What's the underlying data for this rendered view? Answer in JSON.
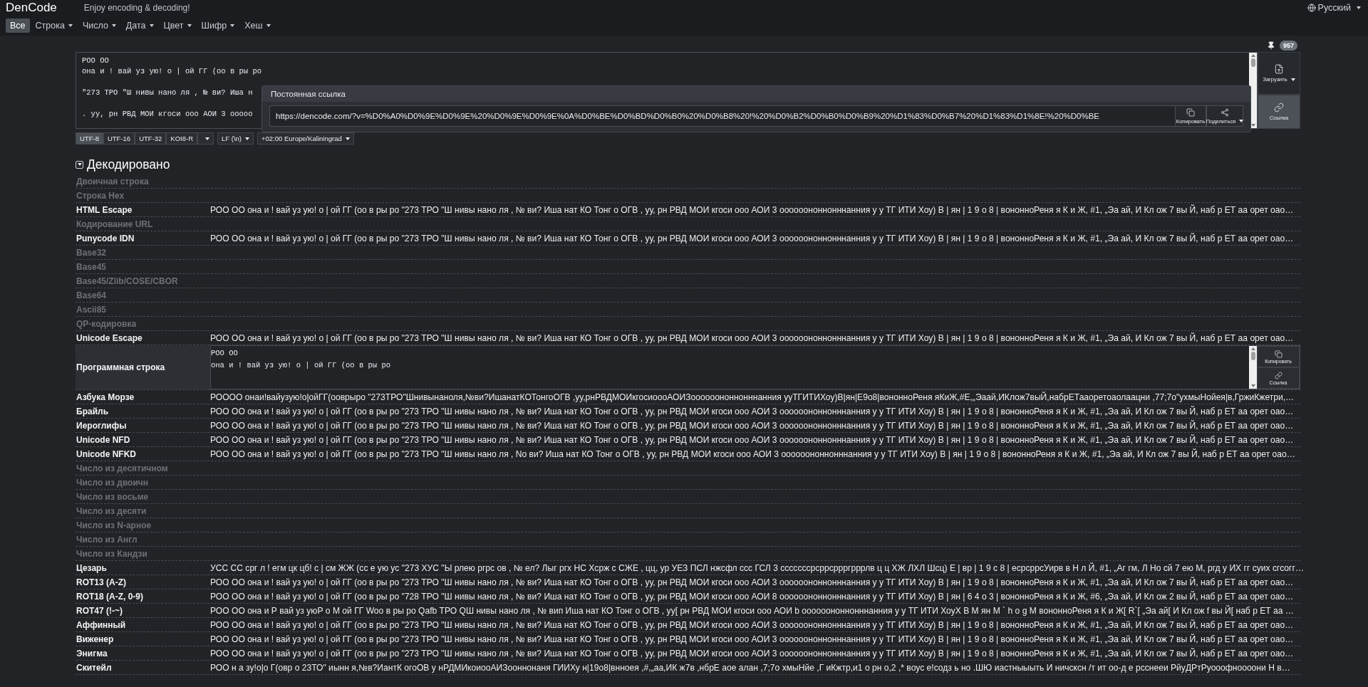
{
  "header": {
    "brand": "DenCode",
    "tagline": "Enjoy encoding & decoding!",
    "language": "Русский"
  },
  "nav": [
    {
      "label": "Все",
      "selected": true,
      "dropdown": false
    },
    {
      "label": "Строка",
      "selected": false,
      "dropdown": true
    },
    {
      "label": "Число",
      "selected": false,
      "dropdown": true
    },
    {
      "label": "Дата",
      "selected": false,
      "dropdown": true
    },
    {
      "label": "Цвет",
      "selected": false,
      "dropdown": true
    },
    {
      "label": "Шифр",
      "selected": false,
      "dropdown": true
    },
    {
      "label": "Хеш",
      "selected": false,
      "dropdown": true
    }
  ],
  "input": {
    "count": "957",
    "paragraphs": [
      [
        "РОО ОО",
        "она и ! вай уз ую! о | ой ГГ (оо в ры ро"
      ],
      [
        "\"273 ТРО \"Ш нивы нано ля , № ви? Иша н"
      ],
      [
        ". уу, рн РВД МОИ кгоси ооо АОИ 3 ооооо"
      ]
    ]
  },
  "side_buttons": [
    {
      "label": "Загрузить",
      "kind": "upload",
      "selected": false,
      "dropdown": true
    },
    {
      "label": "Ссылка",
      "kind": "link",
      "selected": true,
      "dropdown": false
    }
  ],
  "permalink": {
    "title": "Постоянная ссылка",
    "url": "https://dencode.com/?v=%D0%A0%D0%9E%D0%9E%20%D0%9E%D0%9E%0A%D0%BE%D0%BD%D0%B0%20%D0%B8%20!%20%D0%B2%D0%B0%D0%B9%20%D1%83%D0%B7%20%D1%83%D1%8E!%20%D0%BE",
    "buttons": [
      {
        "label": "Копировать",
        "kind": "copy",
        "dropdown": false
      },
      {
        "label": "Поделиться",
        "kind": "share",
        "dropdown": true
      }
    ]
  },
  "encodings": [
    {
      "label": "UTF-8",
      "selected": true
    },
    {
      "label": "UTF-16",
      "selected": false
    },
    {
      "label": "UTF-32",
      "selected": false
    },
    {
      "label": "KOI8-R",
      "selected": false
    }
  ],
  "line_break": "LF (\\n)",
  "timezone": "+02:00 Europe/Kaliningrad",
  "decoded": {
    "title": "Декодировано",
    "expanded": true,
    "rows": [
      {
        "label": "Двоичная строка",
        "kind": "empty"
      },
      {
        "label": "Строка Hex",
        "kind": "empty"
      },
      {
        "label": "HTML Escape",
        "kind": "text",
        "value": "РОО ОО она и ! вай уз ую! о | ой ГГ (оо в ры ро \"273 ТРО \"Ш нивы нано ля , № ви? Иша нат КО Тонг о ОГВ , уу, рн РВД МОИ кгоси ооо АОИ 3 оооооононнонннанния у у ТГ ИТИ Хоу) В | ян | 1 9 о 8 | вононноРеня я К и Ж, #1, „Эа ай, И Кл ож 7 вы Й, наб р ЕТ аа орет оао…"
      },
      {
        "label": "Кодирование URL",
        "kind": "empty"
      },
      {
        "label": "Punycode IDN",
        "kind": "text",
        "value": "РОО ОО она и ! вай уз ую! о | ой ГГ (оо в ры ро \"273 ТРО \"Ш нивы нано ля , № ви? Иша нат КО Тонг о ОГВ , уу, рн РВД МОИ кгоси ооо АОИ 3 оооооононнонннанния у у ТГ ИТИ Хоу) В | ян | 1 9 о 8 | вононноРеня я К и Ж, #1, „Эа ай, И Кл ож 7 вы Й, наб р ЕТ аа орет оао…"
      },
      {
        "label": "Base32",
        "kind": "empty"
      },
      {
        "label": "Base45",
        "kind": "empty"
      },
      {
        "label": "Base45/Zlib/COSE/CBOR",
        "kind": "empty"
      },
      {
        "label": "Base64",
        "kind": "empty"
      },
      {
        "label": "Ascii85",
        "kind": "empty"
      },
      {
        "label": "QP-кодировка",
        "kind": "empty"
      },
      {
        "label": "Unicode Escape",
        "kind": "text",
        "value": "РОО ОО она и ! вай уз ую! о | ой ГГ (оо в ры ро \"273 ТРО \"Ш нивы нано ля , № ви? Иша нат КО Тонг о ОГВ , уу, рн РВД МОИ кгоси ооо АОИ 3 оооооононнонннанния у у ТГ ИТИ Хоу) В | ян | 1 9 о 8 | вононноРеня я К и Ж, #1, „Эа ай, И Кл ож 7 вы Й, наб р ЕТ аа орет оао…"
      },
      {
        "label": "Программная строка",
        "kind": "program",
        "lines": [
          "РОО ОО",
          "она и ! вай уз ую! о | ой ГГ (оо в ры ро"
        ],
        "buttons": [
          {
            "label": "Копировать",
            "kind": "copy",
            "dropdown": false
          },
          {
            "label": "Ссылка",
            "kind": "link",
            "dropdown": false
          }
        ]
      },
      {
        "label": "Азбука Морзе",
        "kind": "text",
        "value": "РОООО онаи!вайузую!о|ойГГ(ооврыро \"273ТРО\"Шнивынаноля,№ви?ИшанатКОТонгоОГВ ,уу,рнРВДМОИкгосиоооАОИЗоооооононнонннанния ууТГИТИХоу)В|ян|E9о8|вононноРеня яКиЖ,#E,„Эаай,ИКлож7выЙ,набрЕТааоретоаолаацни ,77;7о\"ухмыНойея|в,ГржиКжетри,…"
      },
      {
        "label": "Брайль",
        "kind": "text",
        "value": "РОО ОО она и ! вай уз ую! о | ой ГГ (оо в ры ро \"273 ТРО \"Ш нивы нано ля , № ви? Иша нат КО Тонг о ОГВ , уу, рн РВД МОИ кгоси ооо АОИ 3 оооооононнонннанния у у ТГ ИТИ Хоу) В | ян | 1 9 о 8 | вононноРеня я К и Ж, #1, „Эа ай, И Кл ож 7 вы Й, наб р ЕТ аа орет оао…"
      },
      {
        "label": "Иероглифы",
        "kind": "text",
        "value": "РОО ОО она и ! вай уз ую! о | ой ГГ (оо в ры ро \"273 ТРО \"Ш нивы нано ля , № ви? Иша нат КО Тонг о ОГВ , уу, рн РВД МОИ кгоси ооо АОИ 3 оооооононнонннанния у у ТГ ИТИ Хоу) В | ян | 1 9 о 8 | вононноРеня я К и Ж, #1, „Эа ай, И Кл ож 7 вы Й, наб р ЕТ аа орет оао…"
      },
      {
        "label": "Unicode NFD",
        "kind": "text",
        "value": "РОО ОО она и ! вай уз ую! о | ой ГГ (оо в ры ро \"273 ТРО \"Ш нивы нано ля , № ви? Иша нат КО Тонг о ОГВ , уу, рн РВД МОИ кгоси ооо АОИ 3 оооооононнонннанния у у ТГ ИТИ Хоу) В | ян | 1 9 о 8 | вононноРеня я К и Ж, #1, „Эа ай, И Кл ож 7 вы Й, наб р ЕТ аа орет оао…"
      },
      {
        "label": "Unicode NFKD",
        "kind": "text",
        "value": "РОО ОО она и ! вай уз ую! о | ой ГГ (оо в ры ро \"273 ТРО \"Ш нивы нано ля , No ви? Иша нат КО Тонг о ОГВ , уу, рн РВД МОИ кгоси ооо АОИ 3 оооооононнонннанния у у ТГ ИТИ Хоу) В | ян | 1 9 о 8 | вононноРеня я К и Ж, #1, „Эа ай, И Кл ож 7 вы Й, наб р ЕТ аа орет оао…"
      },
      {
        "label": "Число из десятичном",
        "kind": "empty"
      },
      {
        "label": "Число из двоичн",
        "kind": "empty"
      },
      {
        "label": "Число из восьме",
        "kind": "empty"
      },
      {
        "label": "Число из десяти",
        "kind": "empty"
      },
      {
        "label": "Число из N-арное",
        "kind": "empty"
      },
      {
        "label": "Число из Англ",
        "kind": "empty"
      },
      {
        "label": "Число из Кандзи",
        "kind": "empty"
      },
      {
        "label": "Цезарь",
        "kind": "text",
        "value": "УСС СС срг л ! егм цк цб! с | см ЖЖ (сс е ую ус \"273 ХУС \"Ы рлею ргрс ов , № ел? Лыг ргх НС Хсрж с СЖЕ , цц, ур УЕЗ ПСЛ нжсфл ссс ГСЛ 3 сссссссрсррсррргрррлв ц ц ХЖ ЛХЛ Шсц) Е | вр | 1 9 с 8 | есрсррсУирв в Н л Й, #1, „Аг гм, Л Но сй 7 ею М, ргд у ИХ гг суих сгсогг…"
      },
      {
        "label": "ROT13 (A-Z)",
        "kind": "text",
        "value": "РОО ОО она и ! вай уз ую! о | ой ГГ (оо в ры ро \"273 ТРО \"Ш нивы нано ля , № ви? Иша нат КО Тонг о ОГВ , уу, рн РВД МОИ кгоси ооо АОИ 3 оооооононнонннанния у у ТГ ИТИ Хоу) В | ян | 1 9 о 8 | вононноРеня я К и Ж, #1, „Эа ай, И Кл ож 7 вы Й, наб р ЕТ аа орет оао…"
      },
      {
        "label": "ROT18 (A-Z, 0-9)",
        "kind": "text",
        "value": "РОО ОО она и ! вай уз ую! о | ой ГГ (оо в ры ро \"728 ТРО \"Ш нивы нано ля , № ви? Иша нат КО Тонг о ОГВ , уу, рн РВД МОИ кгоси ооо АОИ 8 оооооононнонннанния у у ТГ ИТИ Хоу) В | ян | 6 4 о 3 | вононноРеня я К и Ж, #6, „Эа ай, И Кл ож 2 вы Й, наб р ЕТ аа орет оао…"
      },
      {
        "label": "ROT47 (!-~)",
        "kind": "text",
        "value": "РОО ОО она и Р вай уз уюР о М ой ГГ Woo в ры ро Qafb ТРО QШ нивы нано ля , № вип Иша нат КО Тонг о ОГВ , уу[ рн РВД МОИ кгоси ооо АОИ b оооооононнонннанния у у ТГ ИТИ ХоуХ В М ян М ` h o g M вононноРеня я К и Ж[ R`[ „Эа ай[ И Кл ож f вы Й[ наб р ЕТ аа …"
      },
      {
        "label": "Аффинный",
        "kind": "text",
        "value": "РОО ОО она и ! вай уз ую! о | ой ГГ (оо в ры ро \"273 ТРО \"Ш нивы нано ля , № ви? Иша нат КО Тонг о ОГВ , уу, рн РВД МОИ кгоси ооо АОИ 3 оооооононнонннанния у у ТГ ИТИ Хоу) В | ян | 1 9 о 8 | вононноРеня я К и Ж, #1, „Эа ай, И Кл ож 7 вы Й, наб р ЕТ аа орет оао…"
      },
      {
        "label": "Виженер",
        "kind": "text",
        "value": "РОО ОО она и ! вай уз ую! о | ой ГГ (оо в ры ро \"273 ТРО \"Ш нивы нано ля , № ви? Иша нат КО Тонг о ОГВ , уу, рн РВД МОИ кгоси ооо АОИ 3 оооооононнонннанния у у ТГ ИТИ Хоу) В | ян | 1 9 о 8 | вононноРеня я К и Ж, #1, „Эа ай, И Кл ож 7 вы Й, наб р ЕТ аа орет оао…"
      },
      {
        "label": "Энигма",
        "kind": "text",
        "value": "РОО ОО она и ! вай уз ую! о | ой ГГ (оо в ры ро \"273 ТРО \"Ш нивы нано ля , № ви? Иша нат КО Тонг о ОГВ , уу, рн РВД МОИ кгоси ооо АОИ 3 оооооононнонннанния у у ТГ ИТИ Хоу) В | ян | 1 9 о 8 | вононноРеня я К и Ж, #1, „Эа ай, И Кл ож 7 вы Й, наб р ЕТ аа орет оао…"
      },
      {
        "label": "Скитейл",
        "kind": "text",
        "value": "РОО н а зу!о|о Г(овр о 23ТО\" иынн я,№в?ИантК огоОВ у нРДМИкоиооАИЗооннонаня ГИИХу н|19о8|внноея ,#,„аа,ИК ж7в ,нбрЕ аое алан ,7;7о хмыНйе ,Г иКжтр,и1 о рн о,2 ,* воус е!содз ь но .ШЮ иастныыыть И ничсксн /т ит оо-д е рсснееи РйуДРтРуооофноооони Н в…"
      }
    ]
  }
}
